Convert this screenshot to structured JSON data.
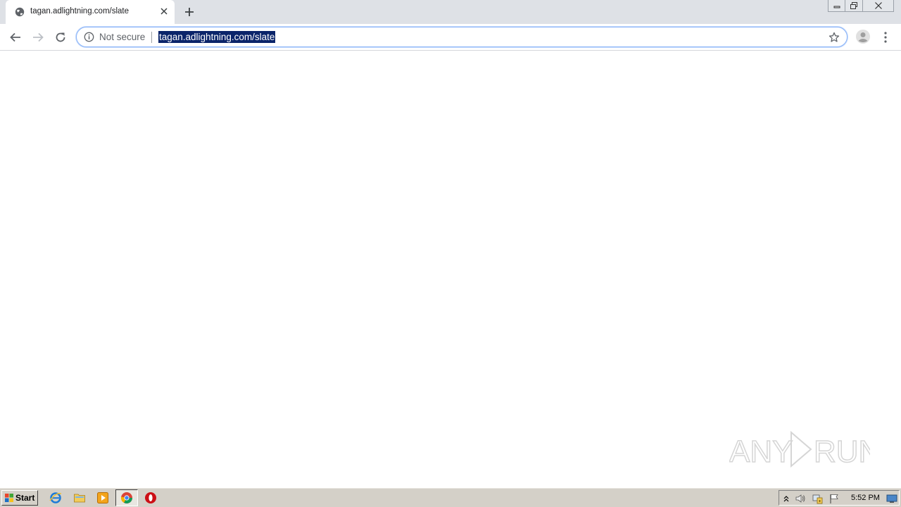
{
  "browser": {
    "tab": {
      "title": "tagan.adlightning.com/slate"
    },
    "address_bar": {
      "security_label": "Not secure",
      "url": "tagan.adlightning.com/slate"
    }
  },
  "watermark": {
    "text": "ANY RUN"
  },
  "taskbar": {
    "start_label": "Start",
    "clock": "5:52 PM"
  },
  "colors": {
    "selection": "#0a246a",
    "tabstrip": "#dee1e6",
    "taskbar": "#d4d0c8"
  }
}
